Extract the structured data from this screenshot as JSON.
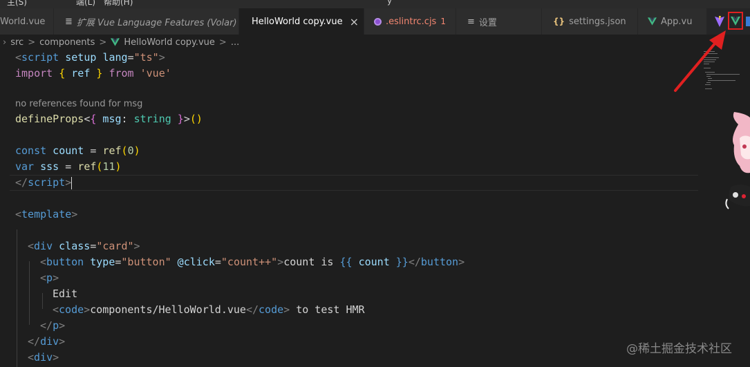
{
  "tabs": [
    {
      "label": "World.vue",
      "icon": "vue-icon",
      "style": "normal"
    },
    {
      "label": "扩展 Vue Language Features (Volar)",
      "icon": "extensions-icon",
      "style": "italic"
    },
    {
      "label": "HelloWorld copy.vue",
      "icon": "vue-icon",
      "style": "active",
      "close": "×"
    },
    {
      "label": ".eslintrc.cjs",
      "badge": "1",
      "icon": "eslint-dot-icon",
      "style": "error"
    },
    {
      "label": "设置",
      "icon": "settings-icon",
      "style": "normal"
    },
    {
      "label": "settings.json",
      "icon": "json-braces-icon",
      "style": "normal"
    },
    {
      "label": "App.vu",
      "icon": "vue-icon",
      "style": "normal"
    }
  ],
  "breadcrumb": {
    "parts": [
      "src",
      "components",
      "HelloWorld copy.vue",
      "..."
    ],
    "separator": ">"
  },
  "code": {
    "codelens": "no references found for msg",
    "lines": {
      "l1": {
        "a": "<",
        "b": "script",
        "c": " setup ",
        "d": "lang",
        "e": "=",
        "f": "\"ts\"",
        "g": ">"
      },
      "l2": {
        "a": "import",
        "b": " { ",
        "c": "ref",
        "d": " } ",
        "e": "from",
        "f": " 'vue'"
      },
      "l4": {
        "a": "defineProps",
        "b": "<",
        "c": "{",
        "d": " msg",
        "e": ": ",
        "f": "string",
        "g": " }",
        "h": ">",
        "i": "()"
      },
      "l6": {
        "a": "const",
        "b": " count",
        "c": " = ",
        "d": "ref",
        "e": "(",
        "f": "0",
        "g": ")"
      },
      "l7": {
        "a": "var",
        "b": " sss",
        "c": " = ",
        "d": "ref",
        "e": "(",
        "f": "11",
        "g": ")"
      },
      "l8": {
        "a": "</",
        "b": "script",
        "c": ">"
      },
      "l10": {
        "a": "<",
        "b": "template",
        "c": ">"
      },
      "l12": {
        "a": "<",
        "b": "div",
        "c": " class",
        "d": "=",
        "e": "\"card\"",
        "f": ">"
      },
      "l13": {
        "a": "<",
        "b": "button",
        "c": " type",
        "d": "=",
        "e": "\"button\"",
        "f": " @click",
        "g": "=",
        "h": "\"count++\"",
        "i": ">",
        "j": "count is ",
        "k": "{{",
        "l": " count ",
        "m": "}}",
        "n": "</",
        "o": "button",
        "p": ">"
      },
      "l14": {
        "a": "<",
        "b": "p",
        "c": ">"
      },
      "l15": {
        "a": "Edit"
      },
      "l16": {
        "a": "<",
        "b": "code",
        "c": ">",
        "d": "components/HelloWorld.vue",
        "e": "</",
        "f": "code",
        "g": ">",
        "h": " to test HMR"
      },
      "l17": {
        "a": "</",
        "b": "p",
        "c": ">"
      },
      "l18": {
        "a": "</",
        "b": "div",
        "c": ">"
      },
      "l19": {
        "a": "<",
        "b": "div",
        "c": ">"
      }
    }
  },
  "toolbar": {
    "vite_icon": "vite-icon",
    "volar_icon": "volar-icon",
    "highlight_color": "#e02020"
  },
  "watermark": "@稀土掘金技术社区",
  "top_strip": {
    "fragments": [
      "主(S)",
      "端(L)",
      "帮助(H)",
      "y"
    ]
  }
}
